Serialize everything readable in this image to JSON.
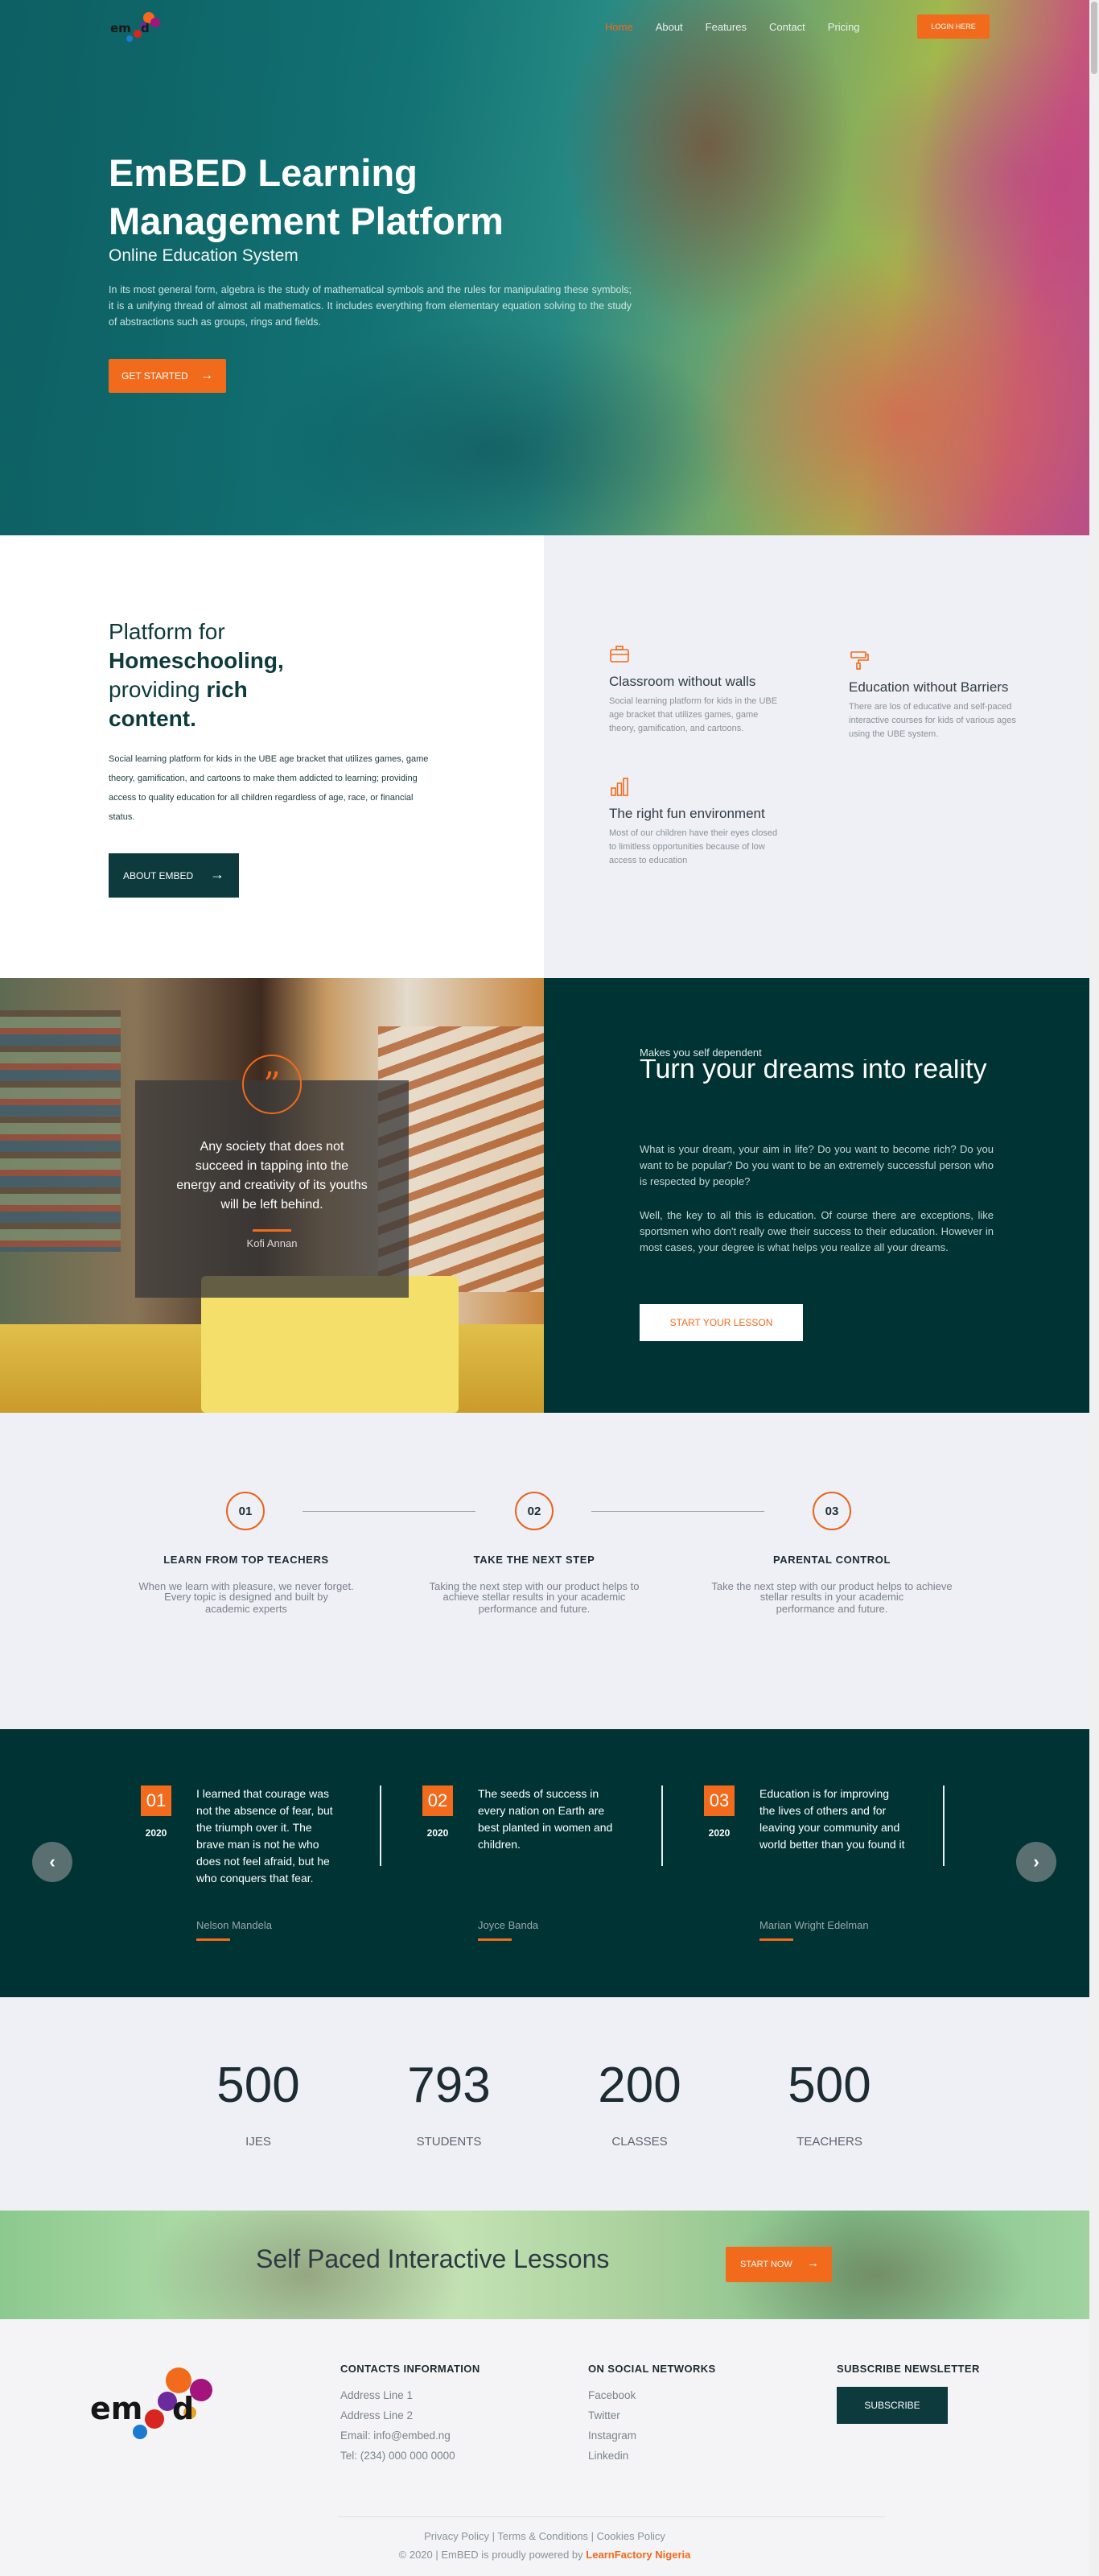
{
  "nav": {
    "links": [
      "Home",
      "About",
      "Features",
      "Contact",
      "Pricing"
    ],
    "active": "Home",
    "login_label": "LOGIN HERE"
  },
  "hero": {
    "title": "EmBED Learning Management Platform",
    "subtitle": "Online Education System",
    "description": "In its most general form, algebra is the study of mathematical symbols and the rules for manipulating these symbols; it is a unifying thread of almost all mathematics. It includes everything from elementary equation solving to the study of abstractions such as groups, rings and fields.",
    "cta_label": "GET STARTED"
  },
  "platform": {
    "title_1": "Platform for",
    "title_2": "Homeschooling,",
    "title_3": "providing",
    "title_4": "rich",
    "title_5": "content.",
    "description": "Social learning platform for kids in the UBE age bracket that utilizes games, game theory, gamification, and cartoons to make them addicted to learning; providing access to quality education for all children regardless of age, race, or financial status.",
    "button_label": "ABOUT EMBED",
    "features": [
      {
        "title": "Classroom without walls",
        "text": "Social learning platform for kids in the UBE age bracket that utilizes games, game theory, gamification, and cartoons."
      },
      {
        "title": "Education without Barriers",
        "text": "There are los of educative and self-paced interactive courses for kids of various ages using the UBE system."
      },
      {
        "title": "The right fun environment",
        "text": "Most of our children have their eyes closed to limitless opportunities because of low access to education"
      }
    ]
  },
  "quote": {
    "mark": "”",
    "text": "Any society that does not succeed in tapping into the energy and creativity of its youths will be left behind.",
    "author": "Kofi Annan"
  },
  "dreams": {
    "kicker": "Makes you self dependent",
    "title": "Turn your dreams into reality",
    "p1": "What is your dream, your aim in life? Do you want to become rich? Do you want to be popular? Do you want to be an extremely successful person who is respected by people?",
    "p2": "Well, the key to all this is education. Of course there are exceptions, like sportsmen who don't really owe their success to their education. However in most cases, your degree is what helps you realize all your dreams.",
    "button_label": "START YOUR LESSON"
  },
  "steps": [
    {
      "num": "01",
      "title": "LEARN FROM TOP TEACHERS",
      "text_1": "When we learn with pleasure, we never forget. Every topic is designed and built by",
      "text_2": "academic experts"
    },
    {
      "num": "02",
      "title": "TAKE THE NEXT STEP",
      "text_1": "Taking the next step with our product helps to achieve stellar results in your academic",
      "text_2": "performance and future."
    },
    {
      "num": "03",
      "title": "PARENTAL CONTROL",
      "text_1": "Take the next step with our product helps to achieve stellar results in your academic",
      "text_2": "performance and future."
    }
  ],
  "testimonials": [
    {
      "num": "01",
      "year": "2020",
      "text": "I learned that courage was not the absence of fear, but the triumph over it. The brave man is not he who does not feel afraid, but he who conquers that fear.",
      "author": "Nelson Mandela"
    },
    {
      "num": "02",
      "year": "2020",
      "text": "The seeds of success in every nation on Earth are best planted in women and children.",
      "author": "Joyce Banda"
    },
    {
      "num": "03",
      "year": "2020",
      "text": "Education is for improving the lives of others and for leaving your community and world better than you found it",
      "author": "Marian Wright Edelman"
    }
  ],
  "counts": [
    {
      "value": "500",
      "label": "IJES"
    },
    {
      "value": "793",
      "label": "STUDENTS"
    },
    {
      "value": "200",
      "label": "CLASSES"
    },
    {
      "value": "500",
      "label": "TEACHERS"
    }
  ],
  "banner": {
    "title": "Self Paced Interactive Lessons",
    "button_label": "START NOW"
  },
  "footer": {
    "logo_text": "embed",
    "contacts_head": "CONTACTS INFORMATION",
    "contacts": [
      "Address Line 1",
      "Address Line 2",
      "Email: info@embed.ng",
      "Tel: (234) 000 000 0000"
    ],
    "social_head": "ON SOCIAL NETWORKS",
    "social": [
      "Facebook",
      "Twitter",
      "Instagram",
      "Linkedin"
    ],
    "newsletter_head": "SUBSCRIBE NEWSLETTER",
    "subscribe_label": "SUBSCRIBE",
    "policy_links": "Privacy Policy  | Terms & Conditions  | Cookies Policy",
    "copyright": "© 2020 | EmBED is proudly powered by",
    "powered_by": "LearnFactory Nigeria"
  },
  "colors": {
    "accent": "#f26a1b",
    "dark_teal": "#003334",
    "navy_teal": "#0d3a3c"
  }
}
